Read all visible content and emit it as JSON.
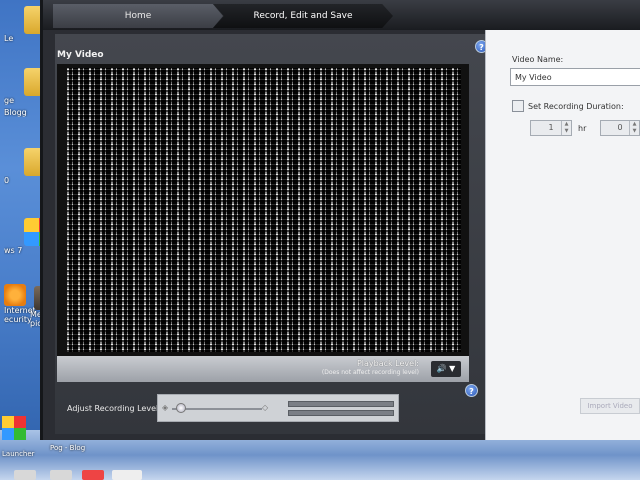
{
  "desktop": {
    "icons": [
      {
        "label": "Le",
        "kind": "folder"
      },
      {
        "label": "ge",
        "kind": "folder"
      },
      {
        "label": "Blogg",
        "kind": "folder"
      },
      {
        "label": "0",
        "kind": "folder"
      },
      {
        "label": "ws 7",
        "kind": "grid"
      },
      {
        "label": "Internet",
        "kind": "orange"
      },
      {
        "label": "ecurity",
        "kind": "orange"
      },
      {
        "label": "Mess",
        "kind": "person"
      },
      {
        "label": "pictu",
        "kind": "person"
      }
    ],
    "taskbar_labels": [
      "Launcher",
      "Pog - Blog"
    ]
  },
  "app": {
    "tabs": {
      "home": "Home",
      "record": "Record, Edit and Save"
    },
    "video_title": "My Video",
    "help_glyph": "?",
    "playback_label": "Playback Level:",
    "playback_sub": "(Does not affect recording level)",
    "adjust_label": "Adjust Recording Level:"
  },
  "right_panel": {
    "video_name_label": "Video Name:",
    "video_name_value": "My Video",
    "duration_label": "Set Recording Duration:",
    "hours_value": "1",
    "hours_unit": "hr",
    "minutes_value": "0",
    "import_button": "Import Video"
  },
  "colors": {
    "accent_help": "#2a57b8",
    "window_bg": "#2b2d33"
  }
}
